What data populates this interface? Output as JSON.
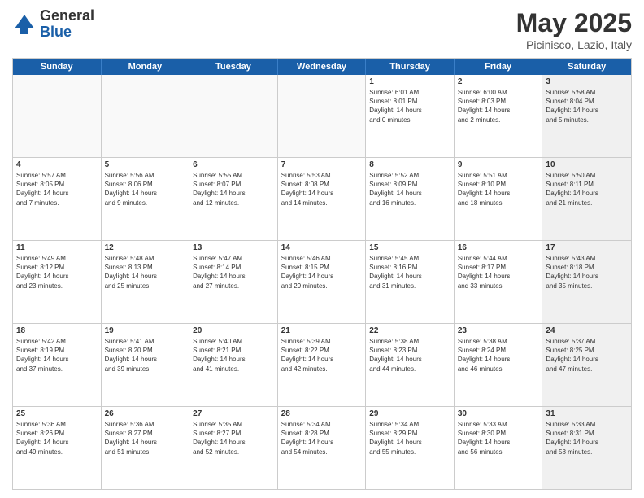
{
  "logo": {
    "general": "General",
    "blue": "Blue"
  },
  "title": "May 2025",
  "subtitle": "Picinisco, Lazio, Italy",
  "header_days": [
    "Sunday",
    "Monday",
    "Tuesday",
    "Wednesday",
    "Thursday",
    "Friday",
    "Saturday"
  ],
  "rows": [
    [
      {
        "day": "",
        "lines": [],
        "empty": true
      },
      {
        "day": "",
        "lines": [],
        "empty": true
      },
      {
        "day": "",
        "lines": [],
        "empty": true
      },
      {
        "day": "",
        "lines": [],
        "empty": true
      },
      {
        "day": "1",
        "lines": [
          "Sunrise: 6:01 AM",
          "Sunset: 8:01 PM",
          "Daylight: 14 hours",
          "and 0 minutes."
        ]
      },
      {
        "day": "2",
        "lines": [
          "Sunrise: 6:00 AM",
          "Sunset: 8:03 PM",
          "Daylight: 14 hours",
          "and 2 minutes."
        ]
      },
      {
        "day": "3",
        "lines": [
          "Sunrise: 5:58 AM",
          "Sunset: 8:04 PM",
          "Daylight: 14 hours",
          "and 5 minutes."
        ],
        "shaded": true
      }
    ],
    [
      {
        "day": "4",
        "lines": [
          "Sunrise: 5:57 AM",
          "Sunset: 8:05 PM",
          "Daylight: 14 hours",
          "and 7 minutes."
        ]
      },
      {
        "day": "5",
        "lines": [
          "Sunrise: 5:56 AM",
          "Sunset: 8:06 PM",
          "Daylight: 14 hours",
          "and 9 minutes."
        ]
      },
      {
        "day": "6",
        "lines": [
          "Sunrise: 5:55 AM",
          "Sunset: 8:07 PM",
          "Daylight: 14 hours",
          "and 12 minutes."
        ]
      },
      {
        "day": "7",
        "lines": [
          "Sunrise: 5:53 AM",
          "Sunset: 8:08 PM",
          "Daylight: 14 hours",
          "and 14 minutes."
        ]
      },
      {
        "day": "8",
        "lines": [
          "Sunrise: 5:52 AM",
          "Sunset: 8:09 PM",
          "Daylight: 14 hours",
          "and 16 minutes."
        ]
      },
      {
        "day": "9",
        "lines": [
          "Sunrise: 5:51 AM",
          "Sunset: 8:10 PM",
          "Daylight: 14 hours",
          "and 18 minutes."
        ]
      },
      {
        "day": "10",
        "lines": [
          "Sunrise: 5:50 AM",
          "Sunset: 8:11 PM",
          "Daylight: 14 hours",
          "and 21 minutes."
        ],
        "shaded": true
      }
    ],
    [
      {
        "day": "11",
        "lines": [
          "Sunrise: 5:49 AM",
          "Sunset: 8:12 PM",
          "Daylight: 14 hours",
          "and 23 minutes."
        ]
      },
      {
        "day": "12",
        "lines": [
          "Sunrise: 5:48 AM",
          "Sunset: 8:13 PM",
          "Daylight: 14 hours",
          "and 25 minutes."
        ]
      },
      {
        "day": "13",
        "lines": [
          "Sunrise: 5:47 AM",
          "Sunset: 8:14 PM",
          "Daylight: 14 hours",
          "and 27 minutes."
        ]
      },
      {
        "day": "14",
        "lines": [
          "Sunrise: 5:46 AM",
          "Sunset: 8:15 PM",
          "Daylight: 14 hours",
          "and 29 minutes."
        ]
      },
      {
        "day": "15",
        "lines": [
          "Sunrise: 5:45 AM",
          "Sunset: 8:16 PM",
          "Daylight: 14 hours",
          "and 31 minutes."
        ]
      },
      {
        "day": "16",
        "lines": [
          "Sunrise: 5:44 AM",
          "Sunset: 8:17 PM",
          "Daylight: 14 hours",
          "and 33 minutes."
        ]
      },
      {
        "day": "17",
        "lines": [
          "Sunrise: 5:43 AM",
          "Sunset: 8:18 PM",
          "Daylight: 14 hours",
          "and 35 minutes."
        ],
        "shaded": true
      }
    ],
    [
      {
        "day": "18",
        "lines": [
          "Sunrise: 5:42 AM",
          "Sunset: 8:19 PM",
          "Daylight: 14 hours",
          "and 37 minutes."
        ]
      },
      {
        "day": "19",
        "lines": [
          "Sunrise: 5:41 AM",
          "Sunset: 8:20 PM",
          "Daylight: 14 hours",
          "and 39 minutes."
        ]
      },
      {
        "day": "20",
        "lines": [
          "Sunrise: 5:40 AM",
          "Sunset: 8:21 PM",
          "Daylight: 14 hours",
          "and 41 minutes."
        ]
      },
      {
        "day": "21",
        "lines": [
          "Sunrise: 5:39 AM",
          "Sunset: 8:22 PM",
          "Daylight: 14 hours",
          "and 42 minutes."
        ]
      },
      {
        "day": "22",
        "lines": [
          "Sunrise: 5:38 AM",
          "Sunset: 8:23 PM",
          "Daylight: 14 hours",
          "and 44 minutes."
        ]
      },
      {
        "day": "23",
        "lines": [
          "Sunrise: 5:38 AM",
          "Sunset: 8:24 PM",
          "Daylight: 14 hours",
          "and 46 minutes."
        ]
      },
      {
        "day": "24",
        "lines": [
          "Sunrise: 5:37 AM",
          "Sunset: 8:25 PM",
          "Daylight: 14 hours",
          "and 47 minutes."
        ],
        "shaded": true
      }
    ],
    [
      {
        "day": "25",
        "lines": [
          "Sunrise: 5:36 AM",
          "Sunset: 8:26 PM",
          "Daylight: 14 hours",
          "and 49 minutes."
        ]
      },
      {
        "day": "26",
        "lines": [
          "Sunrise: 5:36 AM",
          "Sunset: 8:27 PM",
          "Daylight: 14 hours",
          "and 51 minutes."
        ]
      },
      {
        "day": "27",
        "lines": [
          "Sunrise: 5:35 AM",
          "Sunset: 8:27 PM",
          "Daylight: 14 hours",
          "and 52 minutes."
        ]
      },
      {
        "day": "28",
        "lines": [
          "Sunrise: 5:34 AM",
          "Sunset: 8:28 PM",
          "Daylight: 14 hours",
          "and 54 minutes."
        ]
      },
      {
        "day": "29",
        "lines": [
          "Sunrise: 5:34 AM",
          "Sunset: 8:29 PM",
          "Daylight: 14 hours",
          "and 55 minutes."
        ]
      },
      {
        "day": "30",
        "lines": [
          "Sunrise: 5:33 AM",
          "Sunset: 8:30 PM",
          "Daylight: 14 hours",
          "and 56 minutes."
        ]
      },
      {
        "day": "31",
        "lines": [
          "Sunrise: 5:33 AM",
          "Sunset: 8:31 PM",
          "Daylight: 14 hours",
          "and 58 minutes."
        ],
        "shaded": true
      }
    ]
  ]
}
